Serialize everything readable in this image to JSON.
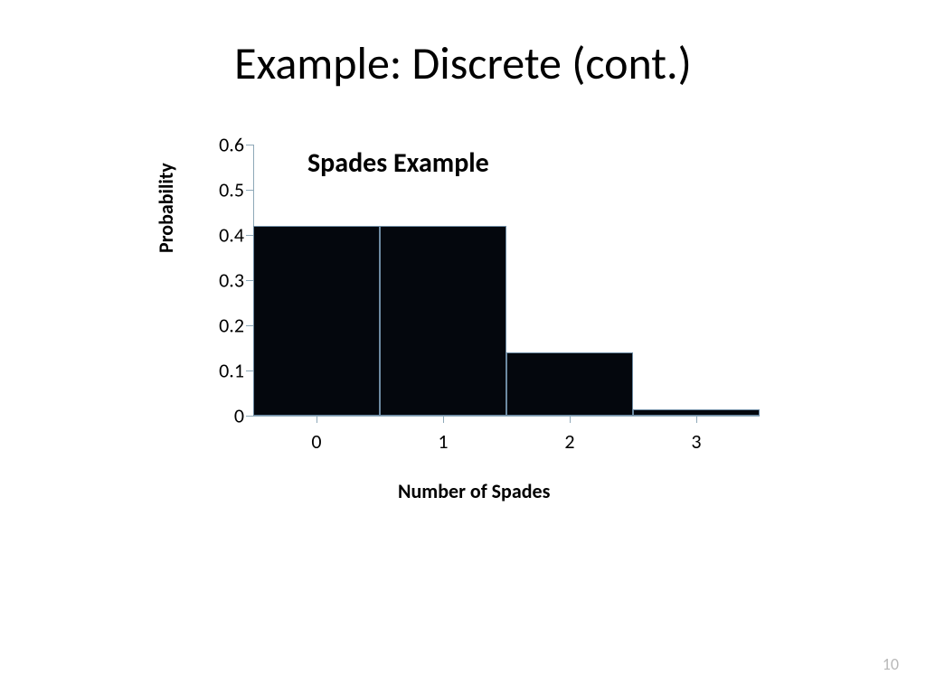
{
  "slide": {
    "title": "Example: Discrete (cont.)",
    "page_number": "10"
  },
  "chart_data": {
    "type": "bar",
    "title": "Spades Example",
    "xlabel": "Number of Spades",
    "ylabel": "Probability",
    "categories": [
      "0",
      "1",
      "2",
      "3"
    ],
    "values": [
      0.42,
      0.42,
      0.14,
      0.015
    ],
    "ylim": [
      0,
      0.6
    ],
    "yticks": [
      0,
      0.1,
      0.2,
      0.3,
      0.4,
      0.5,
      0.6
    ],
    "ytick_labels": [
      "0",
      "0.1",
      "0.2",
      "0.3",
      "0.4",
      "0.5",
      "0.6"
    ]
  }
}
